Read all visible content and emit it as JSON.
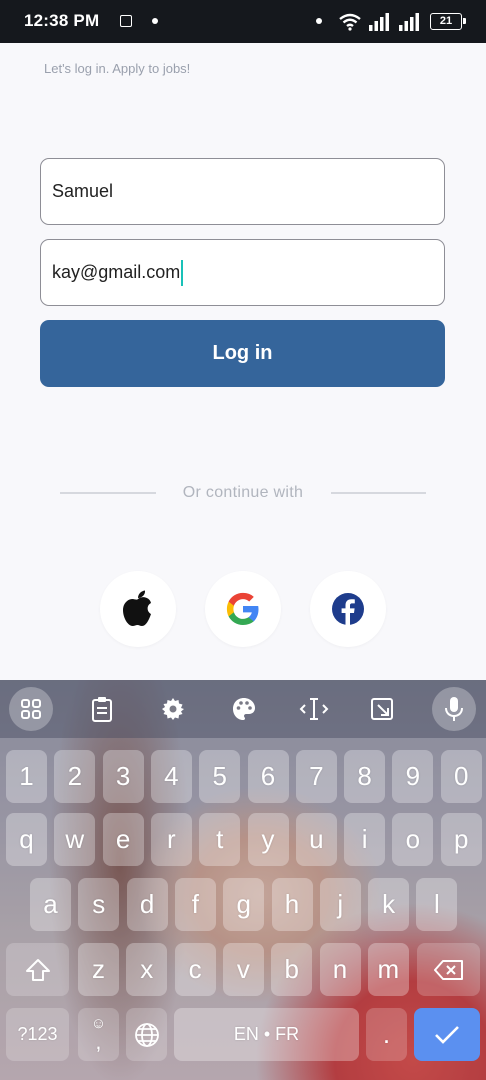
{
  "status_bar": {
    "time": "12:38 PM",
    "battery": "21"
  },
  "tagline": "Let's log in. Apply to jobs!",
  "form": {
    "name_value": "Samuel",
    "email_value": "kay@gmail.com",
    "login_label": "Log in"
  },
  "divider": {
    "text": "Or continue with"
  },
  "social": [
    "apple-icon",
    "google-icon",
    "facebook-icon"
  ],
  "colors": {
    "primary": "#35659b",
    "caret": "#19c1b8",
    "enter": "#5b90f0"
  },
  "keyboard": {
    "toolbar": [
      "apps-grid-icon",
      "clipboard-icon",
      "settings-icon",
      "palette-icon",
      "text-cursor-icon",
      "resize-icon",
      "microphone-icon"
    ],
    "numbers": [
      "1",
      "2",
      "3",
      "4",
      "5",
      "6",
      "7",
      "8",
      "9",
      "0"
    ],
    "row1": [
      "q",
      "w",
      "e",
      "r",
      "t",
      "y",
      "u",
      "i",
      "o",
      "p"
    ],
    "row2": [
      "a",
      "s",
      "d",
      "f",
      "g",
      "h",
      "j",
      "k",
      "l"
    ],
    "row3": [
      "z",
      "x",
      "c",
      "v",
      "b",
      "n",
      "m"
    ],
    "symbols_label": "?123",
    "comma": ",",
    "space_label": "EN • FR",
    "period": "."
  }
}
